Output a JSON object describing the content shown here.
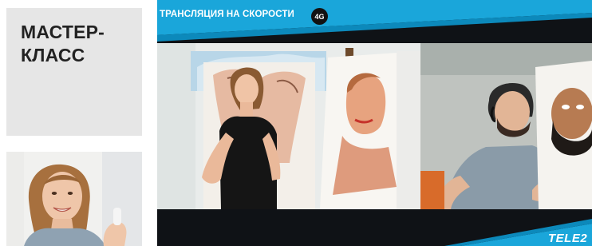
{
  "card": {
    "title_line1": "МАСТЕР-",
    "title_line2": "КЛАСС"
  },
  "hero": {
    "broadcast_label": "ТРАНСЛЯЦИЯ НА СКОРОСТИ",
    "network_badge": "4G",
    "brand": "TELE2"
  },
  "colors": {
    "banner_blue": "#1aa6da",
    "banner_dark": "#0f1216",
    "card_bg": "#e6e6e6",
    "title_text": "#222222"
  },
  "icons": {
    "network_badge": "4g-badge-icon"
  }
}
